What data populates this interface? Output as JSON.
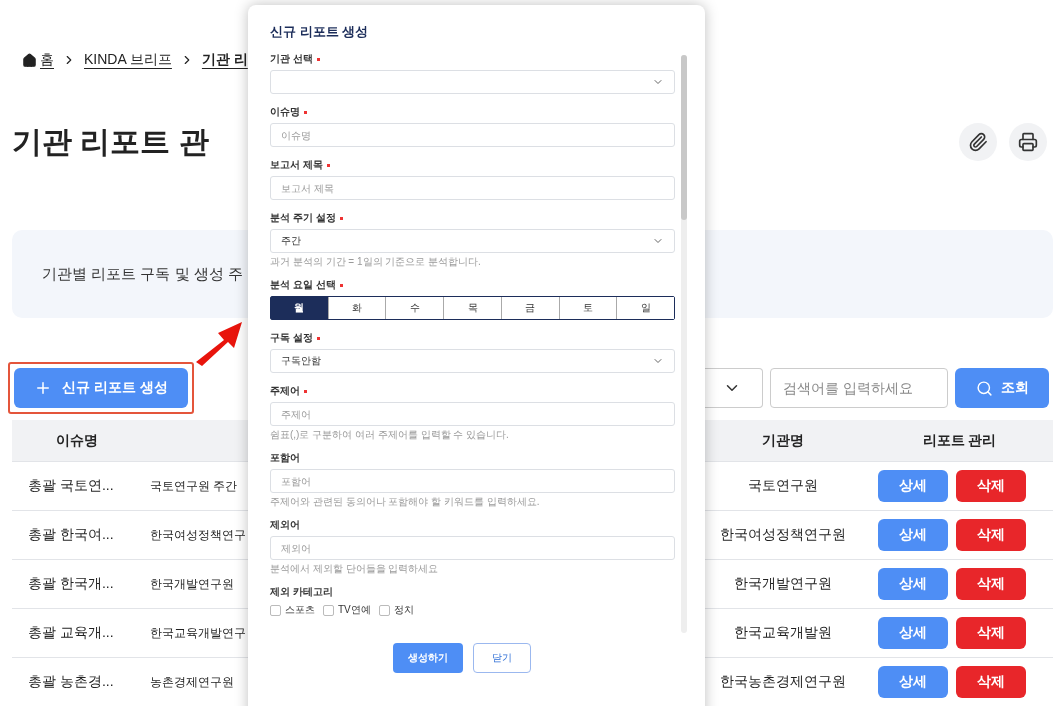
{
  "breadcrumb": [
    {
      "label": "홈",
      "kind": "home"
    },
    {
      "label": "KINDA 브리프",
      "kind": "link"
    },
    {
      "label": "기관 리",
      "kind": "current"
    }
  ],
  "page_title": "기관 리포트 관",
  "description": "기관별 리포트 구독 및 생성 주",
  "new_button": {
    "label": "신규 리포트 생성"
  },
  "search": {
    "placeholder": "검색어를 입력하세요",
    "button": "조회"
  },
  "table": {
    "columns": [
      {
        "label": "이슈명",
        "kind": "issue"
      },
      {
        "label": "기관명",
        "kind": "agency"
      },
      {
        "label": "리포트 관리",
        "kind": "actions"
      }
    ],
    "rows": [
      {
        "issue": "총괄 국토연...",
        "title": "국토연구원 주간",
        "agency": "국토연구원",
        "detail": "상세",
        "delete": "삭제"
      },
      {
        "issue": "총괄 한국여...",
        "title": "한국여성정책연구",
        "agency": "한국여성정책연구원",
        "detail": "상세",
        "delete": "삭제"
      },
      {
        "issue": "총괄 한국개...",
        "title": "한국개발연구원",
        "agency": "한국개발연구원",
        "detail": "상세",
        "delete": "삭제"
      },
      {
        "issue": "총괄 교육개...",
        "title": "한국교육개발연구",
        "agency": "한국교육개발원",
        "detail": "상세",
        "delete": "삭제"
      },
      {
        "issue": "총괄 농촌경...",
        "title": "농촌경제연구원",
        "agency": "한국농촌경제연구원",
        "detail": "상세",
        "delete": "삭제"
      }
    ]
  },
  "modal": {
    "title": "신규 리포트 생성",
    "fields": [
      {
        "kind": "select",
        "label": "기관 선택",
        "required": true
      },
      {
        "kind": "input",
        "label": "이슈명",
        "required": true,
        "placeholder": "이슈명"
      },
      {
        "kind": "input",
        "label": "보고서 제목",
        "required": true,
        "placeholder": "보고서 제목"
      },
      {
        "kind": "select",
        "label": "분석 주기 설정",
        "required": true,
        "value": "주간",
        "hint": "과거 분석의 기간 = 1일의 기준으로 분석합니다."
      },
      {
        "kind": "days",
        "label": "분석 요일 선택",
        "required": true,
        "days": [
          {
            "label": "월",
            "selected": true
          },
          {
            "label": "화",
            "selected": false
          },
          {
            "label": "수",
            "selected": false
          },
          {
            "label": "목",
            "selected": false
          },
          {
            "label": "금",
            "selected": false
          },
          {
            "label": "토",
            "selected": false
          },
          {
            "label": "일",
            "selected": false
          }
        ]
      },
      {
        "kind": "select",
        "label": "구독 설정",
        "required": true,
        "value": "구독안함"
      },
      {
        "kind": "input",
        "label": "주제어",
        "required": true,
        "placeholder": "주제어",
        "hint": "쉼표(,)로 구분하여 여러 주제어를 입력할 수 있습니다."
      },
      {
        "kind": "input",
        "label": "포함어",
        "required": false,
        "placeholder": "포함어",
        "hint": "주제어와 관련된 동의어나 포함해야 할 키워드를 입력하세요."
      },
      {
        "kind": "input",
        "label": "제외어",
        "required": false,
        "placeholder": "제외어",
        "hint": "분석에서 제외할 단어들을 입력하세요"
      },
      {
        "kind": "checkboxes",
        "label": "제외 카테고리",
        "required": false,
        "options": [
          {
            "label": "스포츠",
            "checked": false
          },
          {
            "label": "TV연예",
            "checked": false
          },
          {
            "label": "정치",
            "checked": false
          }
        ]
      }
    ],
    "buttons": {
      "submit": "생성하기",
      "close": "닫기"
    }
  }
}
